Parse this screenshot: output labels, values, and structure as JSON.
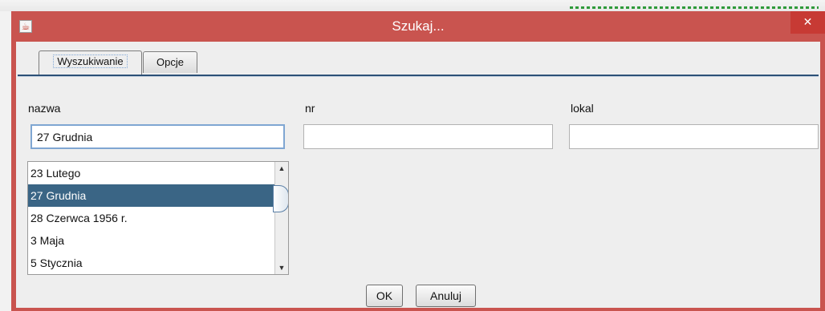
{
  "window": {
    "title": "Szukaj...",
    "close_glyph": "✕",
    "icon": "java-app-icon"
  },
  "tabs": [
    {
      "label": "Wyszukiwanie",
      "active": true
    },
    {
      "label": "Opcje",
      "active": false
    }
  ],
  "fields": {
    "nazwa": {
      "label": "nazwa",
      "value": "27 Grudnia"
    },
    "nr": {
      "label": "nr",
      "value": ""
    },
    "lokal": {
      "label": "lokal",
      "value": ""
    }
  },
  "suggestions": {
    "items": [
      "23 Lutego",
      "27 Grudnia",
      "28 Czerwca 1956 r.",
      "3 Maja",
      "5 Stycznia"
    ],
    "selected_index": 1
  },
  "buttons": {
    "ok": "OK",
    "cancel": "Anuluj"
  },
  "colors": {
    "titlebar": "#c9544f",
    "selection": "#3a6585",
    "dialog_bg": "#eeeeee"
  }
}
